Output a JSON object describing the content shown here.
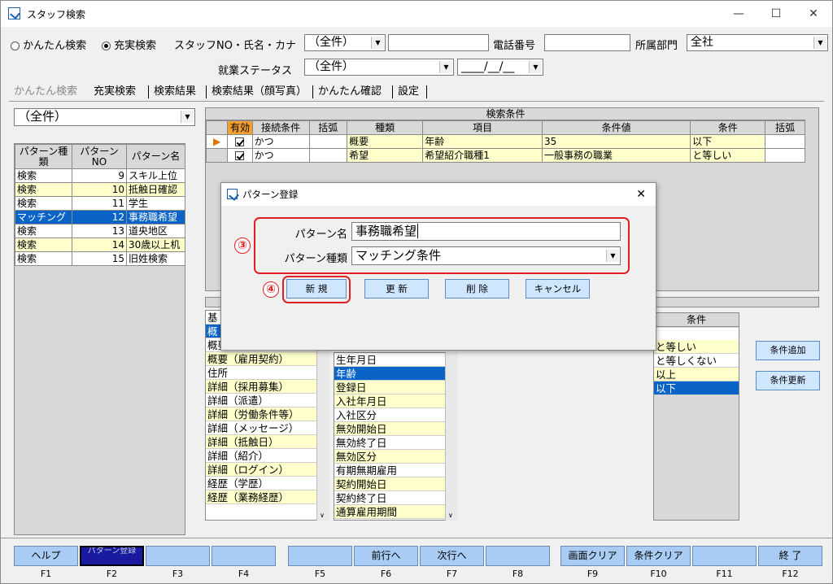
{
  "window": {
    "title": "スタッフ検索",
    "min": "—",
    "max": "☐",
    "close": "✕"
  },
  "search": {
    "radio_simple": "かんたん検索",
    "radio_full": "充実検索",
    "staff_label": "スタッフNO・氏名・カナ",
    "staff_select": "（全件）",
    "phone_label": "電話番号",
    "dept_label": "所属部門",
    "dept_value": "全社",
    "status_label": "就業ステータス",
    "status_value": "（全件）",
    "date_value": "____/__/__"
  },
  "tabs": [
    "かんたん検索",
    "充実検索",
    "検索結果",
    "検索結果（顔写真）",
    "かんたん確認",
    "設定"
  ],
  "left": {
    "filter": "（全件）",
    "headers": [
      "パターン種類",
      "パターンNO",
      "パターン名"
    ],
    "rows": [
      {
        "type": "検索",
        "no": "9",
        "name": "スキル上位"
      },
      {
        "type": "検索",
        "no": "10",
        "name": "抵触日確認"
      },
      {
        "type": "検索",
        "no": "11",
        "name": "学生"
      },
      {
        "type": "マッチング",
        "no": "12",
        "name": "事務職希望"
      },
      {
        "type": "検索",
        "no": "13",
        "name": "道央地区"
      },
      {
        "type": "検索",
        "no": "14",
        "name": "30歳以上机"
      },
      {
        "type": "検索",
        "no": "15",
        "name": "旧姓検索"
      }
    ]
  },
  "conditions": {
    "title": "検索条件",
    "headers": [
      "有効",
      "接続条件",
      "括弧",
      "種類",
      "項目",
      "条件値",
      "条件",
      "括弧"
    ],
    "rows": [
      {
        "conn": "かつ",
        "paren": "",
        "kind": "概要",
        "item": "年齢",
        "value": "35",
        "cond": "以下",
        "paren2": ""
      },
      {
        "conn": "かつ",
        "paren": "",
        "kind": "希望",
        "item": "希望紹介職種1",
        "value": "一般事務の職業",
        "cond": "と等しい",
        "paren2": ""
      }
    ]
  },
  "lower": {
    "kinds": [
      "基",
      "概",
      "概要（ポイント）",
      "概要（雇用契約）",
      "住所",
      "詳細（採用募集）",
      "詳細（派遣）",
      "詳細（労働条件等）",
      "詳細（メッセージ）",
      "詳細（抵触日）",
      "詳細（紹介）",
      "詳細（ログイン）",
      "経歴（学歴）",
      "経歴（業務経歴）"
    ],
    "items": [
      "生年月日",
      "年齢",
      "登録日",
      "入社年月日",
      "入社区分",
      "無効開始日",
      "無効終了日",
      "無効区分",
      "有期無期雇用",
      "契約開始日",
      "契約終了日",
      "通算雇用期間"
    ],
    "cond_header": "条件",
    "conds": [
      "と等しい",
      "と等しくない",
      "以上",
      "以下"
    ],
    "add_button": "条件追加",
    "update_button": "条件更新"
  },
  "dialog": {
    "title": "パターン登録",
    "close": "✕",
    "name_label": "パターン名",
    "name_value": "事務職希望",
    "kind_label": "パターン種類",
    "kind_value": "マッチング条件",
    "new": "新 規",
    "update": "更 新",
    "delete": "削 除",
    "cancel": "キャンセル",
    "marker3": "③",
    "marker4": "④"
  },
  "fkeys": [
    {
      "label": "ヘルプ",
      "key": "F1"
    },
    {
      "label": "パターン登録",
      "key": "F2"
    },
    {
      "label": "",
      "key": "F3"
    },
    {
      "label": "",
      "key": "F4"
    },
    {
      "label": "",
      "key": "F5"
    },
    {
      "label": "前行へ",
      "key": "F6"
    },
    {
      "label": "次行へ",
      "key": "F7"
    },
    {
      "label": "",
      "key": "F8"
    },
    {
      "label": "画面クリア",
      "key": "F9"
    },
    {
      "label": "条件クリア",
      "key": "F10"
    },
    {
      "label": "",
      "key": "F11"
    },
    {
      "label": "終 了",
      "key": "F12"
    }
  ],
  "colors": {
    "accent": "#0a64c8",
    "button": "#cfe6ff",
    "fkey": "#a8ccf4",
    "highlight": "#ffffcc",
    "marker": "#e02020"
  }
}
